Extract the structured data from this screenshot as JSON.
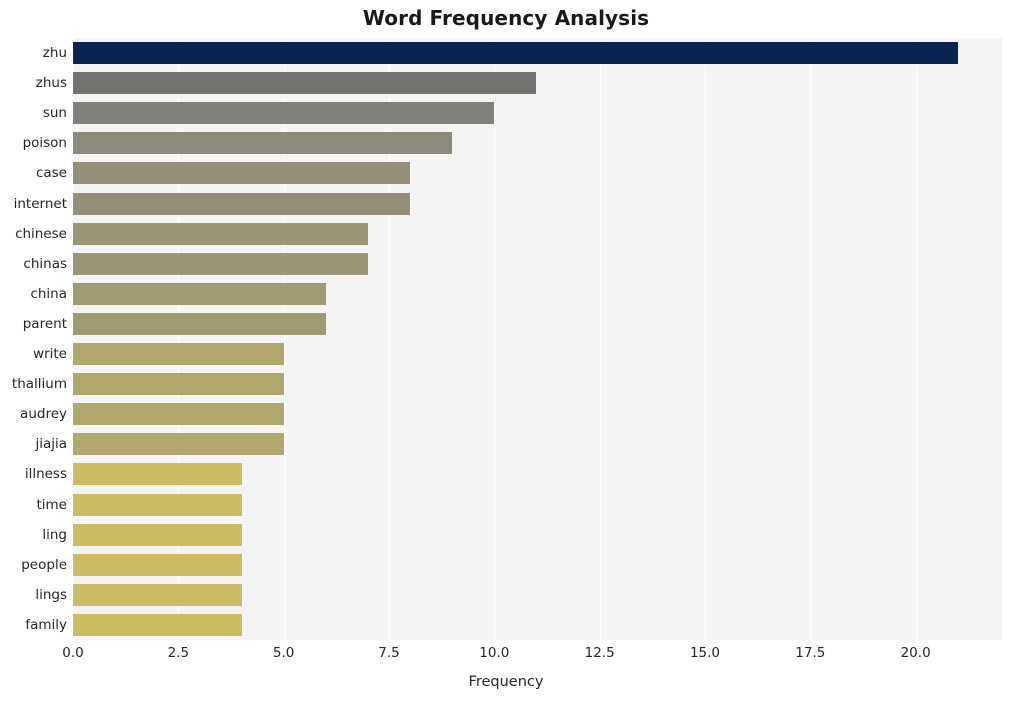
{
  "chart_data": {
    "type": "bar",
    "orientation": "horizontal",
    "title": "Word Frequency Analysis",
    "xlabel": "Frequency",
    "ylabel": "",
    "categories": [
      "zhu",
      "zhus",
      "sun",
      "poison",
      "case",
      "internet",
      "chinese",
      "chinas",
      "china",
      "parent",
      "write",
      "thallium",
      "audrey",
      "jiajia",
      "illness",
      "time",
      "ling",
      "people",
      "lings",
      "family"
    ],
    "values": [
      21,
      11,
      10,
      9,
      8,
      8,
      7,
      7,
      6,
      6,
      5,
      5,
      5,
      5,
      4,
      4,
      4,
      4,
      4,
      4
    ],
    "bar_colors": [
      "#0a2350",
      "#72726f",
      "#81807a",
      "#8c8a7b",
      "#938f79",
      "#938f79",
      "#9a9576",
      "#9a9576",
      "#a09a72",
      "#a09a72",
      "#b0a76c",
      "#b0a76c",
      "#b0a76c",
      "#b0a76c",
      "#cbbc63",
      "#cbbc63",
      "#cbbc63",
      "#cbbc63",
      "#cbbc63",
      "#cbbc63"
    ],
    "xticks": [
      "0.0",
      "2.5",
      "5.0",
      "7.5",
      "10.0",
      "12.5",
      "15.0",
      "17.5",
      "20.0"
    ],
    "xtick_values": [
      0,
      2.5,
      5,
      7.5,
      10,
      12.5,
      15,
      17.5,
      20
    ],
    "xlim": [
      0,
      22.05
    ],
    "grid": true,
    "grid_color": "#ffffff",
    "plot_background": "#f4f4f5",
    "figure_background": "#ffffff",
    "legend": null
  }
}
